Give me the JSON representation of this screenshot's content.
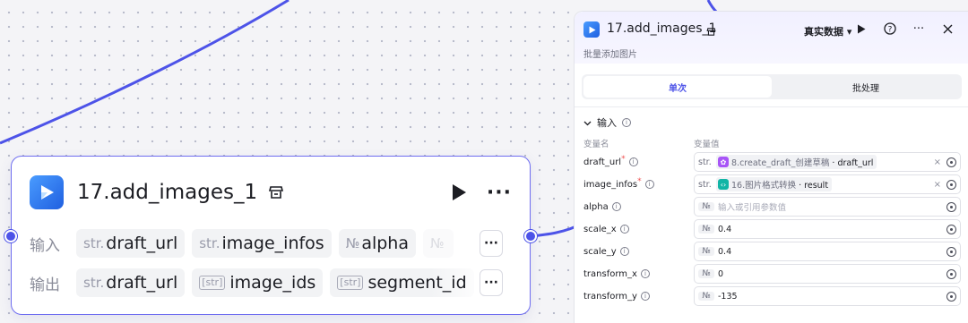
{
  "node": {
    "title": "17.add_images_1",
    "input_label": "输入",
    "output_label": "输出",
    "inputs": [
      {
        "type": "str.",
        "name": "draft_url"
      },
      {
        "type": "str.",
        "name": "image_infos"
      },
      {
        "type": "№",
        "name": "alpha"
      }
    ],
    "outputs": [
      {
        "type": "str.",
        "name": "draft_url"
      },
      {
        "type": "[str]",
        "name": "image_ids"
      },
      {
        "type": "[str]",
        "name": "segment_id"
      }
    ],
    "more": "···"
  },
  "panel": {
    "title": "17.add_images_1",
    "description": "批量添加图片",
    "data_mode": "真实数据",
    "tabs": [
      {
        "label": "单次",
        "active": true
      },
      {
        "label": "批处理",
        "active": false
      }
    ],
    "section": "输入",
    "col_name": "变量名",
    "col_value": "变量值",
    "params": [
      {
        "name": "draft_url",
        "required": true,
        "type": "str.",
        "ref_source": "8.create_draft_创建草稿",
        "ref_field": "draft_url",
        "ref_icon": "purple"
      },
      {
        "name": "image_infos",
        "required": true,
        "type": "str.",
        "ref_source": "16.图片格式转换",
        "ref_field": "result",
        "ref_icon": "teal"
      },
      {
        "name": "alpha",
        "required": false,
        "type": "№",
        "placeholder": "输入或引用参数值"
      },
      {
        "name": "scale_x",
        "required": false,
        "type": "№",
        "value": "0.4"
      },
      {
        "name": "scale_y",
        "required": false,
        "type": "№",
        "value": "0.4"
      },
      {
        "name": "transform_x",
        "required": false,
        "type": "№",
        "value": "0"
      },
      {
        "name": "transform_y",
        "required": false,
        "type": "№",
        "value": "-135"
      }
    ]
  },
  "colors": {
    "accent": "#4d53e8",
    "edge": "#4d53e8",
    "node_border": "#6e6df0"
  }
}
